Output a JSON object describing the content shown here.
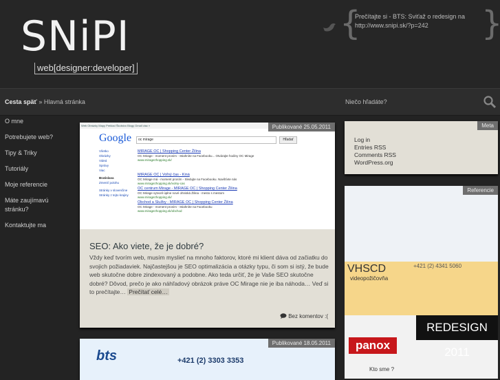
{
  "header": {
    "logo_text": "SNiPI",
    "tagline": "web[designer:developer]",
    "tweet": "Prečítajte si - BTS: Sviťaž o redesign na http://www.snipi.sk/?p=242",
    "brace_open": "{",
    "brace_close": "}"
  },
  "breadcrumb": {
    "back": "Cesta späť",
    "separator": "»",
    "current": "Hlavná stránka"
  },
  "search": {
    "label": "Niečo hľadáte?"
  },
  "nav": {
    "items": [
      "O mne",
      "Potrebujete web?",
      "Tipy & Triky",
      "Tutoriály",
      "Moje referencie",
      "Máte zaujímavú stránku?",
      "Kontaktujte ma"
    ]
  },
  "posts": [
    {
      "date": "Publikované 25.05.2011",
      "title": "SEO: Ako viete, že je dobré?",
      "body": "Vždy keď tvorím web, musím myslieť na mnoho faktorov, ktoré mi klient dáva od začiatku do svojich požiadaviek. Najčastejšou je SEO optimalizácia a otázky typu, či som si istý, že bude web skutočne dobre zindexovaný a podobne. Ako teda určiť, že je Vaše SEO skutočne dobré? Dôvod, prečo je ako náhľadový obrázok práve OC Mirage nie je iba náhoda… Veď si to prečítajte…",
      "more": "Prečítať celé…",
      "comments": "Bez komentov :("
    },
    {
      "date": "Publikované 18.05.2011"
    }
  ],
  "google_mock": {
    "toolbar": "Web  Obrázky  Mapy  Preklad  Školstvo  Blogy  Gmail  viac »",
    "logo": "Google",
    "query": "oc mirage",
    "button": "Hľadať",
    "left_links": [
      "Všetko",
      "Obrázky",
      "Videá",
      "Správy",
      "Viac",
      "Bratislava",
      "Zmeniť polohu",
      "Stránky v slovenčine",
      "Stránky z tejto krajiny"
    ],
    "results": [
      {
        "title": "MIRAGE OC | Shopping Center Žilina",
        "snippet": "OC Mirage - moment prosím - Stiahníte na Facebooku... Otvárajte hodiny OC Mirage",
        "url": "www.miragezhopping.sk/"
      },
      {
        "title": "MIRAGE OC | Voľný čas - Kinà",
        "snippet": "OC Mirage má - moment prosím - Sledujte na Facebooku. Navštívte nás",
        "url": "www.miragezhopping.sk/volny-cas"
      },
      {
        "title": "OC centrum Mirage - MIRAGE OC | Shopping Center Žilina",
        "snippet": "OC Mirage vytvoril úplne nové ohniská Žilina - mesto s mestom",
        "url": "www.miragezhopping.sk/"
      },
      {
        "title": "Obchod a Služby - MIRAGE OC | Shopping Center Žilina",
        "snippet": "OC Mirage - moment prosím - Stiahníte na Facebooku",
        "url": "www.miragezhopping.sk/obchod"
      }
    ]
  },
  "meta": {
    "title": "Meta",
    "links": [
      "Log in",
      "Entries RSS",
      "Comments RSS",
      "WordPress.org"
    ]
  },
  "references": {
    "title": "Referencie",
    "vhs_title": "VHSCD",
    "vhs_sub": "videopožičovňa",
    "vhs_phone": "+421 (2) 4341 5060",
    "redesign": "REDESIGN 2011",
    "panox": "panox",
    "kto": "Kto sme ?"
  },
  "bts_banner": {
    "logo": "bts",
    "phone": "+421 (2) 3303 3353"
  },
  "colors": {
    "background": "#232323",
    "card": "#e2dfd6",
    "tag": "#6e6e6e"
  }
}
